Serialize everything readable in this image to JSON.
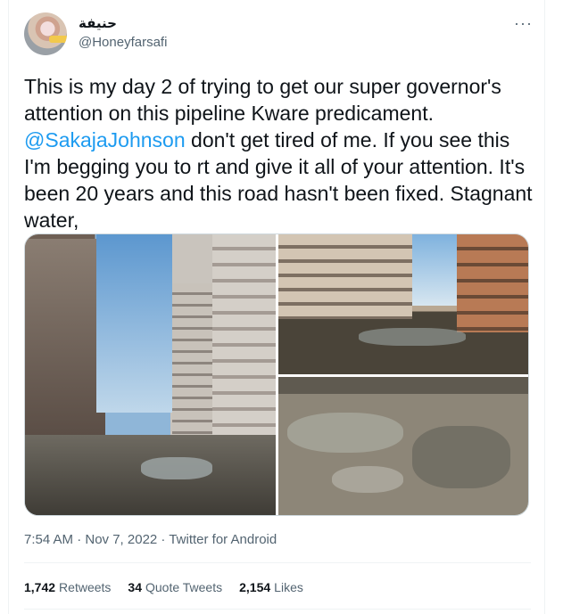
{
  "tweet": {
    "author_name": "حنيفة",
    "author_handle": "@Honeyfarsafi",
    "more_icon": "ellipsis-icon",
    "text_before_mention": "This is my day 2 of trying to get our super governor's attention on this pipeline Kware predicament.",
    "mention": "@SakajaJohnson",
    "text_after_mention": " don't get tired of me. If you see this I'm begging you to rt and give it all of your attention. It's been 20 years and this road hasn't been fixed. Stagnant water,",
    "timestamp": "7:54 AM · Nov 7, 2022",
    "source": "Twitter for Android",
    "source_separator": " · "
  },
  "stats": {
    "retweets_count": "1,742",
    "retweets_label": "Retweets",
    "quotes_count": "34",
    "quotes_label": "Quote Tweets",
    "likes_count": "2,154",
    "likes_label": "Likes"
  },
  "colors": {
    "accent": "#1d9bf0",
    "text": "#0f1419",
    "secondary": "#536471"
  }
}
